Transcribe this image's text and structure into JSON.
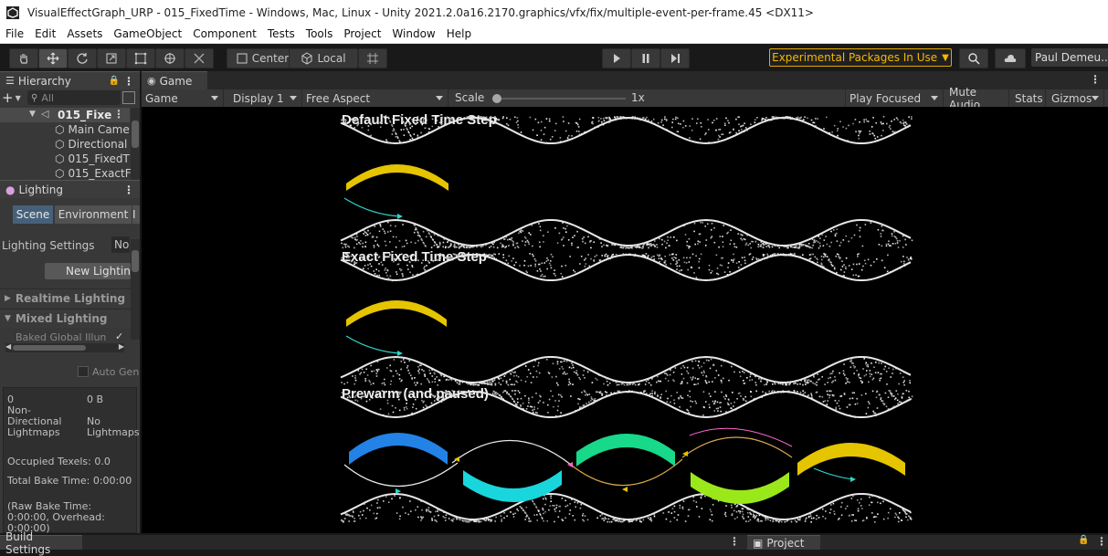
{
  "window": {
    "title": "VisualEffectGraph_URP - 015_FixedTime - Windows, Mac, Linux - Unity 2021.2.0a16.2170.graphics/vfx/fix/multiple-event-per-frame.45 <DX11>"
  },
  "menu": [
    "File",
    "Edit",
    "Assets",
    "GameObject",
    "Component",
    "Tests",
    "Tools",
    "Project",
    "Window",
    "Help"
  ],
  "toolbar": {
    "pivot_mode": "Center",
    "pivot_rotation": "Local",
    "experimental_label": "Experimental Packages In Use",
    "account_label": "Paul Demeu..."
  },
  "hierarchy": {
    "tab_label": "Hierarchy",
    "search_placeholder": "All",
    "scene_name": "015_Fixe",
    "items": [
      "Main Came",
      "Directional",
      "015_FixedT",
      "015_ExactF"
    ]
  },
  "lighting": {
    "tab_label": "Lighting",
    "subtabs": [
      "Scene",
      "Environment",
      "I"
    ],
    "settings_label": "Lighting Settings",
    "settings_value": "No",
    "new_button": "New Lighting",
    "sections": [
      "Realtime Lighting",
      "Mixed Lighting"
    ],
    "baked_gi_label": "Baked Global Illun",
    "auto_gen_label": "Auto Gen",
    "stats": {
      "count": "0",
      "size": "0 B",
      "type_label": "Non-Directional Lightmaps",
      "type_value": "No Lightmaps",
      "occupied": "Occupied Texels: 0.0",
      "total_bake": "Total Bake Time: 0:00:00",
      "raw_bake": "(Raw Bake Time: 0:00:00, Overhead: 0:00:00)"
    }
  },
  "game": {
    "tab_label": "Game",
    "view_mode": "Game",
    "display": "Display 1",
    "aspect": "Free Aspect",
    "scale_label": "Scale",
    "scale_value": "1x",
    "scale_fraction": 0.0,
    "play_mode": "Play Focused",
    "mute": "Mute Audio",
    "stats": "Stats",
    "gizmos": "Gizmos"
  },
  "vfx": {
    "titles": [
      "Default Fixed Time Step",
      "Exact Fixed Time Step",
      "Prewarm (and paused)"
    ]
  },
  "bottom": {
    "left_tab": "Build Settings",
    "right_tab": "Project"
  }
}
